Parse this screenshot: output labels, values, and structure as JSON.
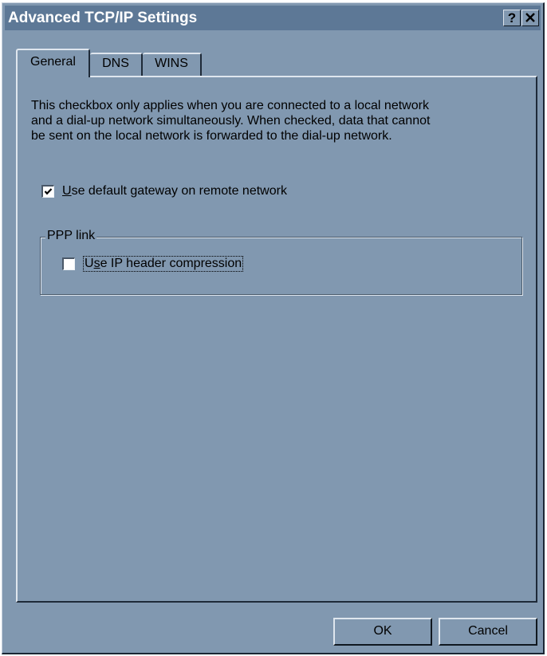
{
  "window": {
    "title": "Advanced TCP/IP Settings",
    "help_button": "?",
    "close_button": "✕"
  },
  "tabs": [
    {
      "label": "General",
      "active": true
    },
    {
      "label": "DNS",
      "active": false
    },
    {
      "label": "WINS",
      "active": false
    }
  ],
  "general": {
    "description": "This checkbox only applies when you are connected to a local network and a dial-up network simultaneously.  When checked, data that cannot be sent on the local network is forwarded to the dial-up network.",
    "default_gateway": {
      "mnemonic": "U",
      "label_rest": "se default gateway on remote network",
      "checked": true
    },
    "ppp_group": {
      "label": "PPP link",
      "header_compression": {
        "prefix": "U",
        "mnemonic": "s",
        "label_rest": "e IP header compression",
        "checked": false
      }
    }
  },
  "buttons": {
    "ok": "OK",
    "cancel": "Cancel"
  },
  "colors": {
    "window_bg": "#8198b0",
    "titlebar_bg": "#5d7896"
  }
}
